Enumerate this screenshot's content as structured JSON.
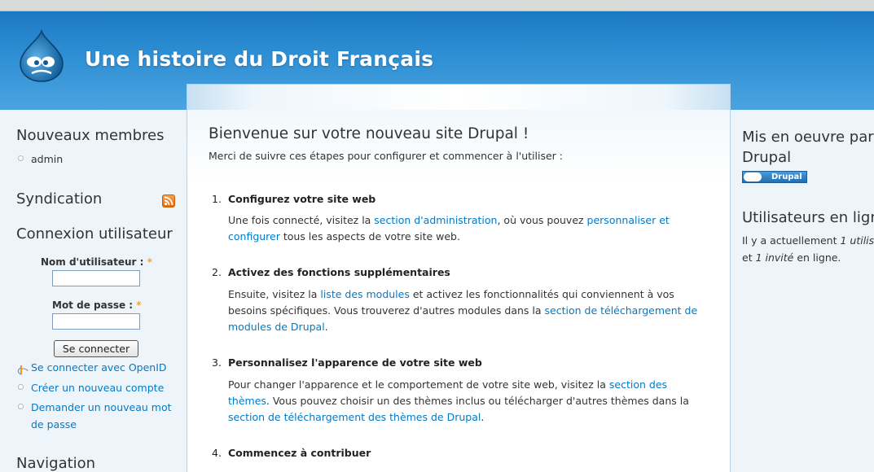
{
  "header": {
    "site_name": "Une histoire du Droit Français"
  },
  "left_sidebar": {
    "new_members": {
      "title": "Nouveaux membres",
      "items": [
        "admin"
      ]
    },
    "syndication": {
      "title": "Syndication"
    },
    "login": {
      "title": "Connexion utilisateur",
      "username_label": "Nom d'utilisateur :",
      "password_label": "Mot de passe :",
      "required_mark": "*",
      "username_value": "",
      "password_value": "",
      "submit_label": "Se connecter",
      "links": {
        "openid": "Se connecter avec OpenID",
        "new_account": "Créer un nouveau compte",
        "new_password_line1": "Demander un nouveau mot",
        "new_password_line2": "de passe"
      }
    },
    "navigation": {
      "title": "Navigation"
    }
  },
  "main": {
    "title": "Bienvenue sur votre nouveau site Drupal !",
    "intro": "Merci de suivre ces étapes pour configurer et commencer à l'utiliser :",
    "steps": [
      {
        "number": "1.",
        "title": "Configurez votre site web",
        "text_a": "Une fois connecté, visitez la ",
        "link_a": "section d'administration",
        "text_b": ", où vous pouvez ",
        "link_b_line1": "personnaliser et",
        "link_b_line2": "configurer",
        "text_c": " tous les aspects de votre site web."
      },
      {
        "number": "2.",
        "title": "Activez des fonctions supplémentaires",
        "text_a": "Ensuite, visitez la ",
        "link_a": "liste des modules",
        "text_b": " et activez les fonctionnalités qui conviennent à vos",
        "line2_text": "besoins spécifiques. Vous trouverez d'autres modules dans la ",
        "link_b_line1": "section de téléchargement de",
        "link_b_line2": "modules de Drupal",
        "text_c": "."
      },
      {
        "number": "3.",
        "title": "Personnalisez l'apparence de votre site web",
        "text_a": "Pour changer l'apparence et le comportement de votre site web, visitez la ",
        "link_a_line1": "section des",
        "link_a_line2": "thèmes",
        "text_b": ". Vous pouvez choisir un des thèmes inclus ou télécharger d'autres thèmes dans la",
        "link_b": "section de téléchargement des thèmes de Drupal",
        "text_c": "."
      },
      {
        "number": "4.",
        "title": "Commencez à contribuer"
      }
    ]
  },
  "right_sidebar": {
    "powered_by": {
      "title_line1": "Mis en oeuvre par",
      "title_line2": "Drupal",
      "badge_label": "Drupal"
    },
    "online": {
      "title": "Utilisateurs en ligne",
      "line1_a": "Il y a actuellement ",
      "line1_b": "1 utilis",
      "line2_a": "et ",
      "line2_b": "1 invité",
      "line2_c": " en ligne."
    }
  },
  "colors": {
    "header_top": "#1c79c3",
    "header_bottom": "#4ba4e0",
    "link": "#027ac6",
    "page_bg": "#edf5fa",
    "required": "#f6a32a"
  }
}
